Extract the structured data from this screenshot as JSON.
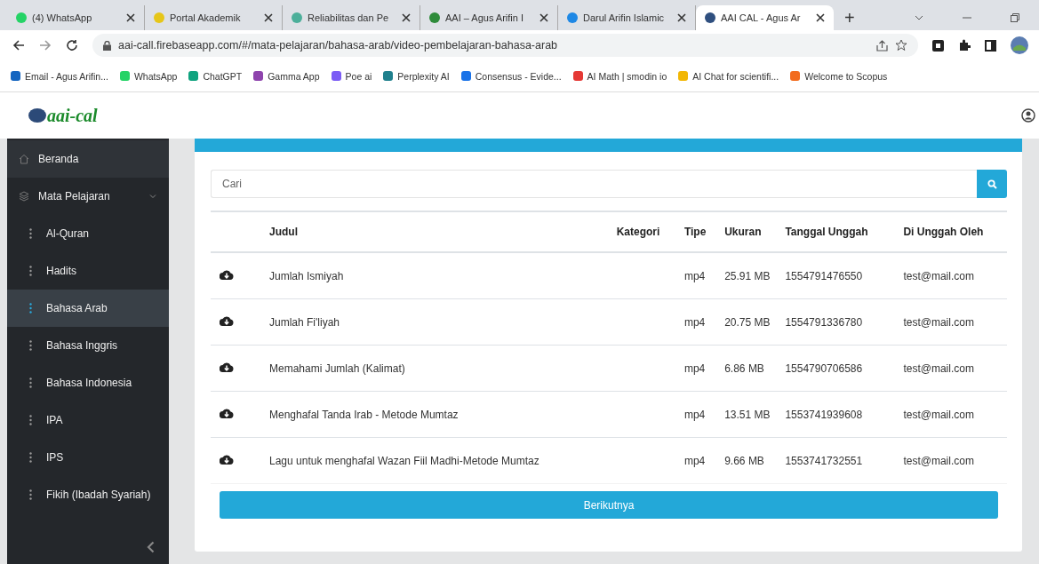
{
  "browser": {
    "tabs": [
      {
        "title": "(4) WhatsApp",
        "color": "#25d366",
        "selected": false
      },
      {
        "title": "Portal Akademik",
        "color": "#e6c619",
        "selected": false
      },
      {
        "title": "Reliabilitas dan Pe",
        "color": "#4caf9a",
        "selected": false
      },
      {
        "title": "AAI – Agus Arifin I",
        "color": "#2e8b3a",
        "selected": false
      },
      {
        "title": "Darul Arifin Islamic",
        "color": "#1e88e5",
        "selected": false
      },
      {
        "title": "AAI CAL - Agus Ar",
        "color": "#2f4f7f",
        "selected": true
      }
    ],
    "new_tab": "+",
    "url": "aai-call.firebaseapp.com/#/mata-pelajaran/bahasa-arab/video-pembelajaran-bahasa-arab",
    "bookmarks": [
      {
        "label": "Email - Agus Arifin...",
        "color": "#1565c0"
      },
      {
        "label": "WhatsApp",
        "color": "#25d366"
      },
      {
        "label": "ChatGPT",
        "color": "#10a37f"
      },
      {
        "label": "Gamma App",
        "color": "#8e44ad"
      },
      {
        "label": "Poe ai",
        "color": "#7b5cf5"
      },
      {
        "label": "Perplexity AI",
        "color": "#20808d"
      },
      {
        "label": "Consensus - Evide...",
        "color": "#1a73e8"
      },
      {
        "label": "AI Math | smodin io",
        "color": "#e53935"
      },
      {
        "label": "AI Chat for scientifi...",
        "color": "#f2b705"
      },
      {
        "label": "Welcome to Scopus",
        "color": "#f26b1d"
      }
    ]
  },
  "app": {
    "logo": "aai-cal"
  },
  "sidebar": {
    "items": [
      {
        "kind": "home",
        "label": "Beranda",
        "selected": false
      },
      {
        "kind": "group",
        "label": "Mata Pelajaran",
        "selected": false,
        "expanded": true,
        "children": [
          {
            "label": "Al-Quran",
            "selected": false
          },
          {
            "label": "Hadits",
            "selected": false
          },
          {
            "label": "Bahasa Arab",
            "selected": true
          },
          {
            "label": "Bahasa Inggris",
            "selected": false
          },
          {
            "label": "Bahasa Indonesia",
            "selected": false
          },
          {
            "label": "IPA",
            "selected": false
          },
          {
            "label": "IPS",
            "selected": false
          },
          {
            "label": "Fikih (Ibadah Syariah)",
            "selected": false
          }
        ]
      }
    ]
  },
  "search": {
    "placeholder": "Cari"
  },
  "table": {
    "columns": [
      "Judul",
      "Kategori",
      "Tipe",
      "Ukuran",
      "Tanggal Unggah",
      "Di Unggah Oleh"
    ],
    "rows": [
      {
        "title": "Jumlah Ismiyah",
        "type": "mp4",
        "size": "25.91 MB",
        "uploaded": "1554791476550",
        "uploader": "test@mail.com"
      },
      {
        "title": "Jumlah Fi'liyah",
        "type": "mp4",
        "size": "20.75 MB",
        "uploaded": "1554791336780",
        "uploader": "test@mail.com"
      },
      {
        "title": "Memahami Jumlah (Kalimat)",
        "type": "mp4",
        "size": "6.86 MB",
        "uploaded": "1554790706586",
        "uploader": "test@mail.com"
      },
      {
        "title": "Menghafal Tanda Irab - Metode Mumtaz",
        "type": "mp4",
        "size": "13.51 MB",
        "uploaded": "1553741939608",
        "uploader": "test@mail.com"
      },
      {
        "title": "Lagu untuk menghafal Wazan Fiil Madhi-Metode Mumtaz",
        "type": "mp4",
        "size": "9.66 MB",
        "uploaded": "1553741732551",
        "uploader": "test@mail.com"
      }
    ]
  },
  "next_button": "Berikutnya"
}
